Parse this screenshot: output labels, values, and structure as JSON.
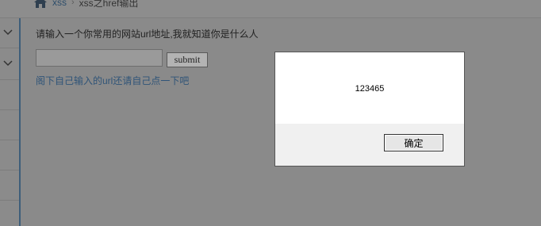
{
  "breadcrumb": {
    "home_icon": "home-icon",
    "link": "xss",
    "separator": "›",
    "current": "xss之href输出"
  },
  "sidebar": {
    "items": [
      {
        "icon": "chevron-down-icon"
      },
      {
        "icon": "chevron-down-icon"
      }
    ]
  },
  "main": {
    "prompt": "请输入一个你常用的网站url地址,我就知道你是什么人",
    "url_input_value": "",
    "submit_label": "submit",
    "hint_link": "阁下自己输入的url还请自己点一下吧"
  },
  "dialog": {
    "message": "123465",
    "ok_label": "确定"
  },
  "colors": {
    "overlay_gray": "#8a8a8a",
    "link_blue": "#2f5478",
    "sidebar_accent": "#3e5e7a"
  }
}
